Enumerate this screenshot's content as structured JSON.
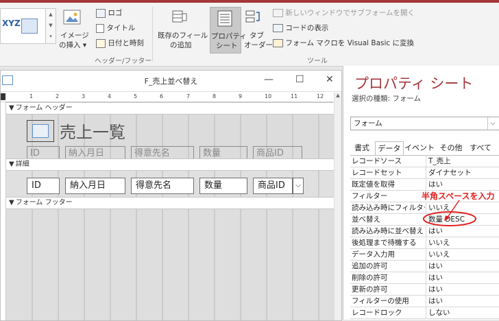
{
  "ribbon": {
    "theme_sample_text": "XYZ",
    "logo": "ロゴ",
    "title": "タイトル",
    "datetime": "日付と時刻",
    "insert_image": "イメージ",
    "insert_image2": "の挿入",
    "header_footer_group": "ヘッダー/フッター",
    "add_existing_field": "既存のフィールド",
    "add_existing_field2": "の追加",
    "property_sheet": "プロパティ",
    "property_sheet2": "シート",
    "tab_order": "タブ",
    "tab_order2": "オーダー",
    "open_subform_new_window": "新しいウィンドウでサブフォームを開く",
    "view_code": "コードの表示",
    "convert_macros": "フォーム マクロを Visual Basic に変換",
    "tools_group": "ツール"
  },
  "form_window": {
    "title": "F_売上並べ替え",
    "ruler_numbers": [
      "1",
      "2",
      "3",
      "4",
      "5",
      "6",
      "7",
      "8",
      "9",
      "10",
      "11",
      "12"
    ],
    "header_section": "フォーム ヘッダー",
    "detail_section": "詳細",
    "footer_section": "フォーム フッター",
    "form_title": "売上一覧",
    "header_labels": [
      "ID",
      "納入月日",
      "得意先名",
      "数量",
      "商品ID"
    ],
    "detail_fields": [
      "ID",
      "納入月日",
      "得意先名",
      "数量",
      "商品ID"
    ]
  },
  "property_sheet": {
    "title": "プロパティ シート",
    "selection_type": "選択の種類: フォーム",
    "object_combo": "フォーム",
    "tabs": [
      "書式",
      "データ",
      "イベント",
      "その他",
      "すべて"
    ],
    "active_tab": "データ",
    "rows": [
      {
        "name": "レコードソース",
        "value": "T_売上"
      },
      {
        "name": "レコードセット",
        "value": "ダイナセット"
      },
      {
        "name": "既定値を取得",
        "value": "はい"
      },
      {
        "name": "フィルター",
        "value": ""
      },
      {
        "name": "読み込み時にフィルター",
        "value": "いいえ"
      },
      {
        "name": "並べ替え",
        "value": "数量 DESC"
      },
      {
        "name": "読み込み時に並べ替え",
        "value": "はい"
      },
      {
        "name": "後処理まで待機する",
        "value": "いいえ"
      },
      {
        "name": "データ入力用",
        "value": "いいえ"
      },
      {
        "name": "追加の許可",
        "value": "はい"
      },
      {
        "name": "削除の許可",
        "value": "はい"
      },
      {
        "name": "更新の許可",
        "value": "はい"
      },
      {
        "name": "フィルターの使用",
        "value": "はい"
      },
      {
        "name": "レコードロック",
        "value": "しない"
      }
    ],
    "annotation": "半角スペースを入力"
  },
  "colors": {
    "accent": "#a4373a",
    "annotation": "#e02020"
  }
}
